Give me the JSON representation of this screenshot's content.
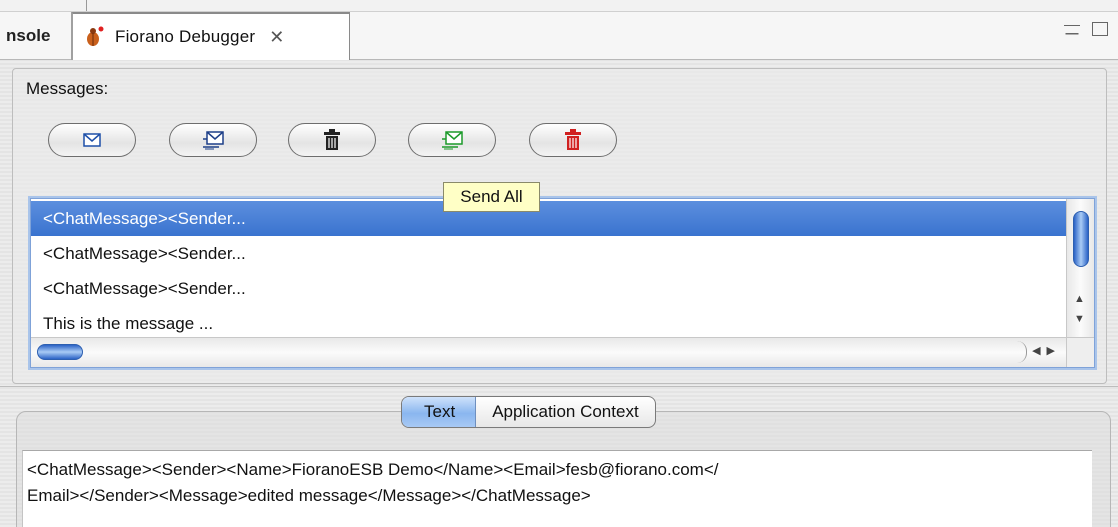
{
  "tabs": {
    "console_label": "nsole",
    "debugger_label": "Fiorano Debugger",
    "close_glyph": "✕"
  },
  "messages": {
    "label": "Messages:",
    "toolbar_icons": [
      "envelope-icon",
      "edit-message-icon",
      "trash-icon",
      "send-all-icon",
      "delete-all-icon"
    ],
    "tooltip": "Send All",
    "items": [
      "<ChatMessage><Sender...",
      "<ChatMessage><Sender...",
      "<ChatMessage><Sender...",
      "This is the message ..."
    ],
    "selected_index": 0
  },
  "detail_tabs": {
    "text": "Text",
    "application_context": "Application Context",
    "selected": "Text"
  },
  "detail": {
    "line1": "<ChatMessage><Sender><Name>FioranoESB Demo</Name><Email>fesb@fiorano.com</",
    "line2": "Email></Sender><Message>edited message</Message></ChatMessage>"
  },
  "colors": {
    "selection": "#3f78d1",
    "tooltip_bg": "#ffffc6",
    "send_icon": "#1c9a2a",
    "delete_icon": "#d02020"
  }
}
